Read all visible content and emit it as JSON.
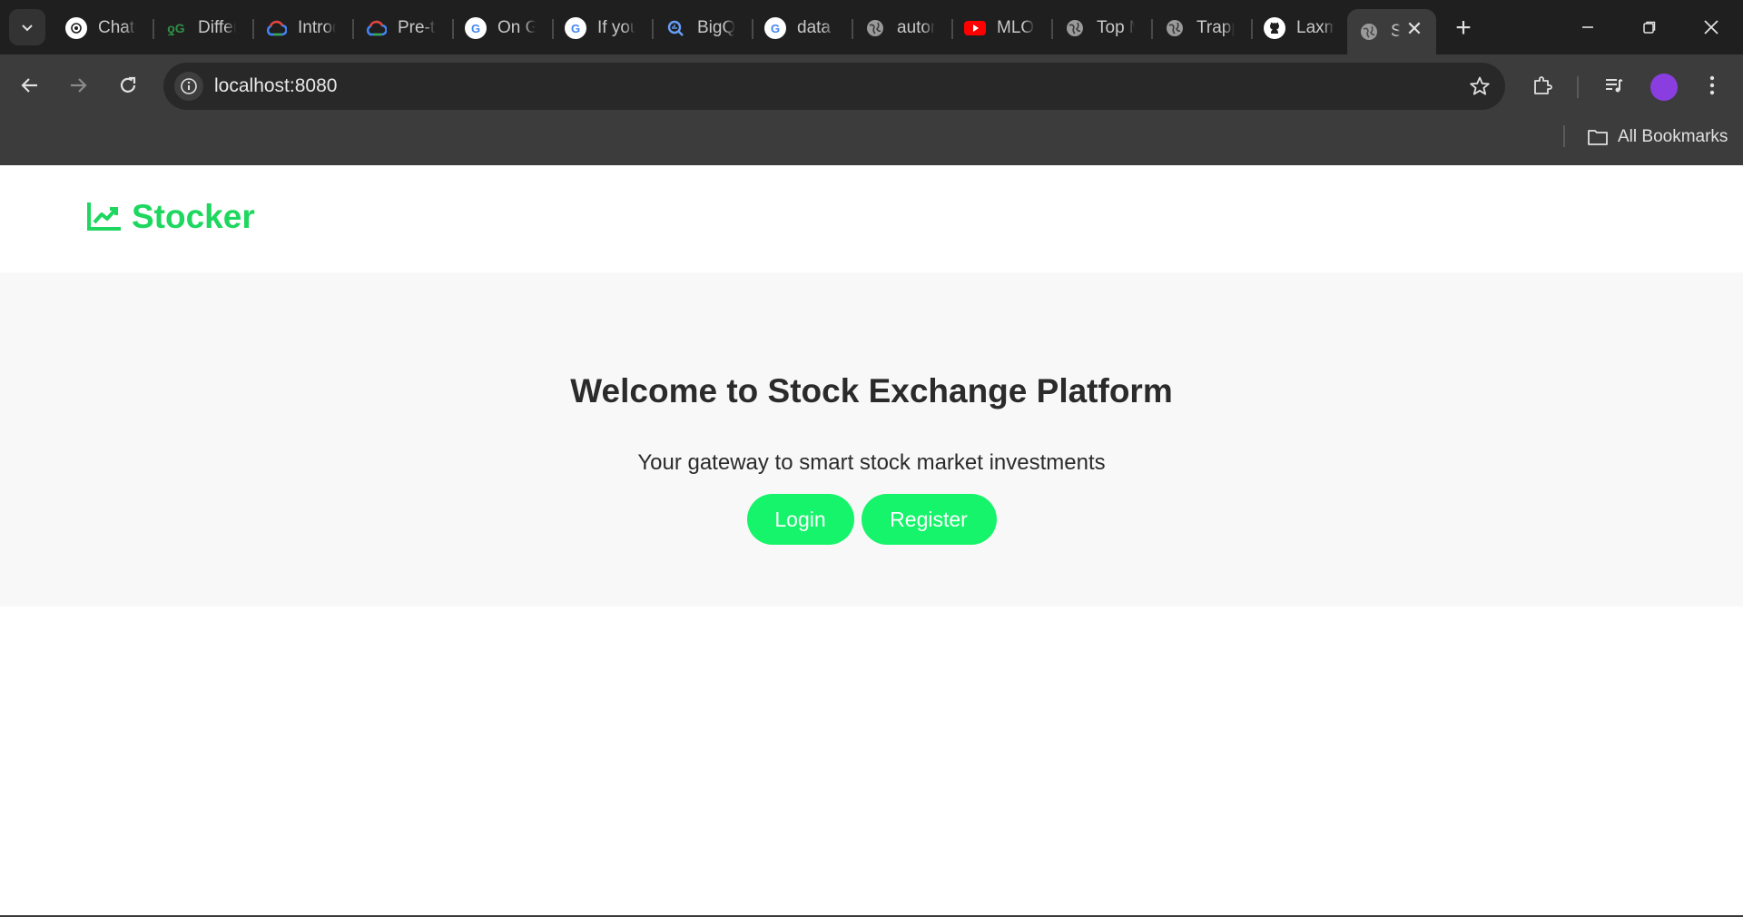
{
  "browser": {
    "tabs": [
      {
        "title": "ChatGPT",
        "icon": "chatgpt-icon",
        "color": "#ffffff"
      },
      {
        "title": "Difference",
        "icon": "geeksforgeeks-icon",
        "color": "#2f8d46"
      },
      {
        "title": "Introduction",
        "icon": "google-cloud-icon",
        "color": "#ea4335"
      },
      {
        "title": "Pre-trained",
        "icon": "google-cloud-icon",
        "color": "#4285f4"
      },
      {
        "title": "On Google",
        "icon": "google-icon",
        "color": "#ffffff"
      },
      {
        "title": "If you",
        "icon": "google-icon",
        "color": "#ffffff"
      },
      {
        "title": "BigQuery",
        "icon": "bigquery-icon",
        "color": "#669df6"
      },
      {
        "title": "data",
        "icon": "google-icon",
        "color": "#ffffff"
      },
      {
        "title": "automl",
        "icon": "globe-icon",
        "color": "#9a9a9a"
      },
      {
        "title": "MLOps",
        "icon": "youtube-icon",
        "color": "#ff0000"
      },
      {
        "title": "Top ML",
        "icon": "globe-icon",
        "color": "#9a9a9a"
      },
      {
        "title": "Trapping",
        "icon": "globe-icon",
        "color": "#9a9a9a"
      },
      {
        "title": "Laxmi",
        "icon": "github-icon",
        "color": "#ffffff"
      },
      {
        "title": "Stocker",
        "icon": "globe-icon",
        "color": "#9a9a9a",
        "active": true
      }
    ],
    "address": "localhost:8080",
    "bookmarks_label": "All Bookmarks",
    "profile_color": "#8a3ee0"
  },
  "site": {
    "brand": "Stocker",
    "brand_icon": "chart-line-icon",
    "brand_color": "#1ed75f",
    "hero": {
      "title": "Welcome to Stock Exchange Platform",
      "subtitle": "Your gateway to smart stock market investments",
      "login_label": "Login",
      "register_label": "Register",
      "button_color": "#15f46a"
    }
  }
}
